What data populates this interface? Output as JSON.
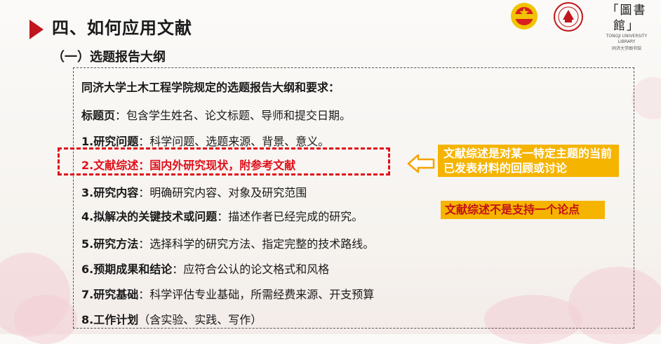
{
  "header": {
    "title": "四、如何应用文献",
    "subtitle": "（一）选题报告大纲"
  },
  "logos": {
    "library_title": "「圖書館」",
    "library_en": "TONGJI UNIVERSITY LIBRARY",
    "library_cn": "同济大学图书馆"
  },
  "outline": {
    "heading": "同济大学土木工程学院规定的选题报告大纲和要求：",
    "items": [
      {
        "label": "标题页",
        "sep": "：",
        "text": "包含学生姓名、论文标题、导师和提交日期。"
      },
      {
        "label": "1.研究问题",
        "sep": "：",
        "text": "科学问题、选题来源、背景、意义。"
      },
      {
        "label": "2.文献综述",
        "sep": "：",
        "text": "国内外研究现状，附参考文献"
      },
      {
        "label": "3.研究内容",
        "sep": "：",
        "text": "明确研究内容、对象及研究范围"
      },
      {
        "label": "4.拟解决的关键技术或问题",
        "sep": "：",
        "text": "描述作者已经完成的研究。"
      },
      {
        "label": "5.研究方法",
        "sep": "：",
        "text": "选择科学的研究方法、指定完整的技术路线。"
      },
      {
        "label": "6.预期成果和结论",
        "sep": "：",
        "text": "应符合公认的论文格式和风格"
      },
      {
        "label": "7.研究基础",
        "sep": "：",
        "text": "科学评估专业基础，所需经费来源、开支预算"
      },
      {
        "label": "8.工作计划",
        "sep": "",
        "text": "（含实验、实践、写作）"
      }
    ]
  },
  "callouts": {
    "definition": "文献综述是对某一特定主题的当前已发表材料的回顾或讨论",
    "not_argument": "文献综述不是支持一个论点"
  },
  "colors": {
    "accent_red": "#c0161d",
    "highlight_red": "#e0101a",
    "callout_bg": "#f5b400"
  }
}
